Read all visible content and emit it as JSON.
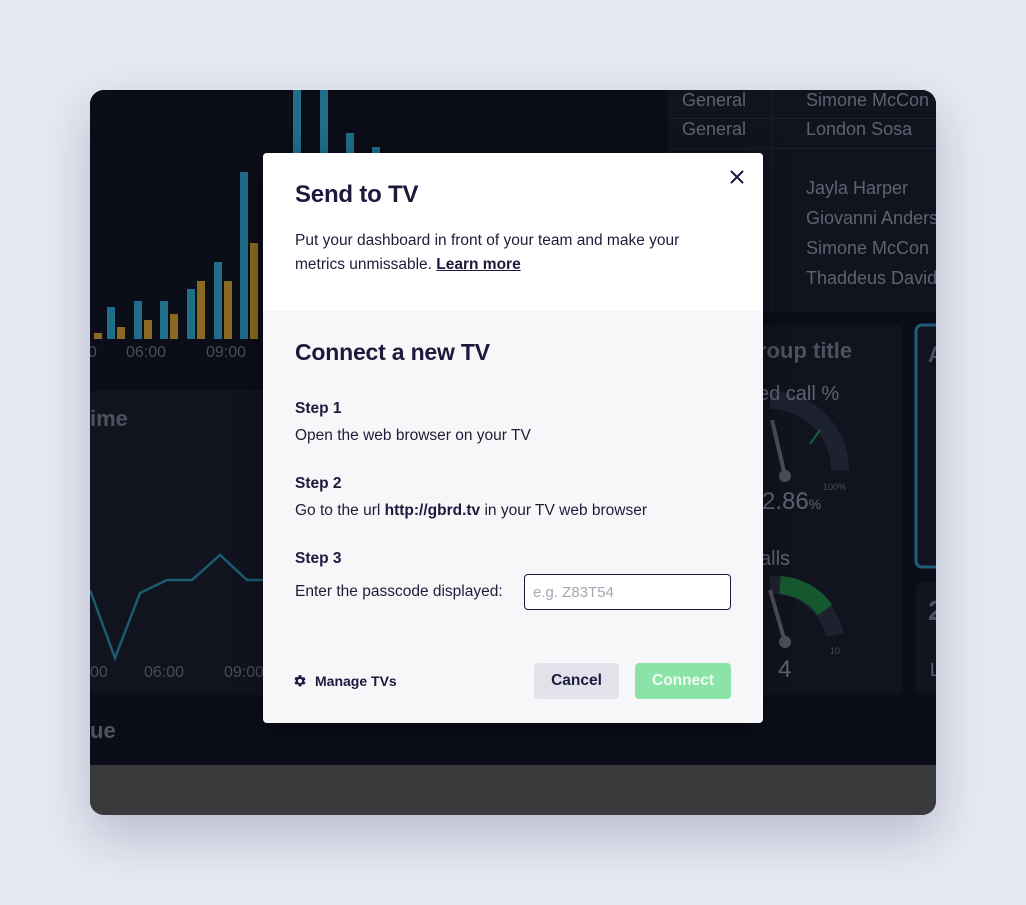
{
  "modal": {
    "title": "Send to TV",
    "description": "Put your dashboard in front of your team and make your metrics unmissable.",
    "learn_more": "Learn more",
    "section_title": "Connect a new TV",
    "steps": [
      {
        "label": "Step 1",
        "text": "Open the web browser on your TV"
      },
      {
        "label": "Step 2",
        "text_before": "Go to the url ",
        "url": "http://gbrd.tv",
        "text_after": " in your TV web browser"
      },
      {
        "label": "Step 3",
        "text": "Enter the passcode displayed:"
      }
    ],
    "passcode_placeholder": "e.g. Z83T54",
    "manage_tvs": "Manage TVs",
    "cancel": "Cancel",
    "connect": "Connect"
  },
  "background": {
    "table": [
      {
        "group": "General",
        "name": "Simone McCon"
      },
      {
        "group": "General",
        "name": "London Sosa"
      },
      {
        "group": "",
        "name": "Jayla Harper"
      },
      {
        "group": "",
        "name": "Giovanni Anders"
      },
      {
        "group": "",
        "name": "Simone McCon"
      },
      {
        "group": "",
        "name": "Thaddeus David"
      }
    ],
    "bar_chart_ticks": [
      "0",
      "06:00",
      "09:00"
    ],
    "line_chart_title": "ime",
    "line_chart_ticks": [
      "00",
      "06:00",
      "09:00"
    ],
    "bottom_label": "ue",
    "group_title": "roup title",
    "gauge1_label": "ed call %",
    "gauge1_value": "2.86",
    "gauge1_unit": "%",
    "gauge1_max": "100%",
    "gauge2_label": "alls",
    "gauge2_value": "4",
    "gauge2_max": "10",
    "right_card_letter": "A",
    "right_card_number": "2",
    "right_card_letter2": "L"
  },
  "colors": {
    "accent_green": "#8be3a8",
    "text_dark": "#1b1a3d",
    "bar_blue": "#1f6e8c",
    "bar_gold": "#8a6a22"
  }
}
